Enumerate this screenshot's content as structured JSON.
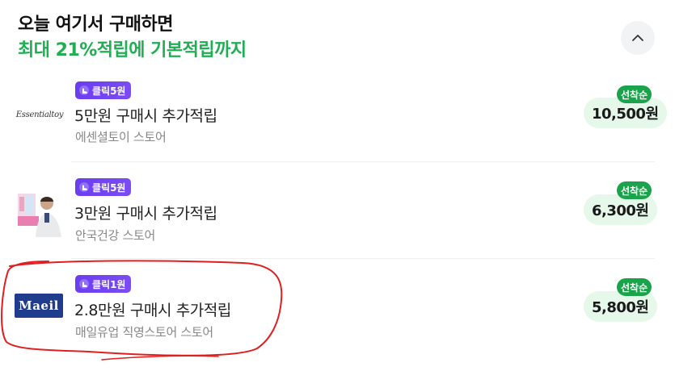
{
  "header": {
    "title_line1": "오늘 여기서 구매하면",
    "title_line2": "최대 21%적립에 기본적립까지"
  },
  "colors": {
    "accent_green": "#1fae52",
    "badge_purple": "#6a3df0",
    "reward_bg": "#e5f8ea",
    "first_tag": "#19a34a",
    "annotation_red": "#e02020"
  },
  "items": [
    {
      "logo_text": "Essentialtoy",
      "badge": "클릭5원",
      "title": "5만원 구매시 추가적립",
      "store": "에센셜토이 스토어",
      "reward": "10,500원",
      "tag": "선착순"
    },
    {
      "logo_text": "",
      "badge": "클릭5원",
      "title": "3만원 구매시 추가적립",
      "store": "안국건강 스토어",
      "reward": "6,300원",
      "tag": "선착순"
    },
    {
      "logo_text": "Maeil",
      "badge": "클릭1원",
      "title": "2.8만원 구매시 추가적립",
      "store": "매일유업 직영스토어 스토어",
      "reward": "5,800원",
      "tag": "선착순"
    }
  ],
  "icons": {
    "collapse": "chevron-up-icon",
    "badge": "click-hand-icon"
  }
}
